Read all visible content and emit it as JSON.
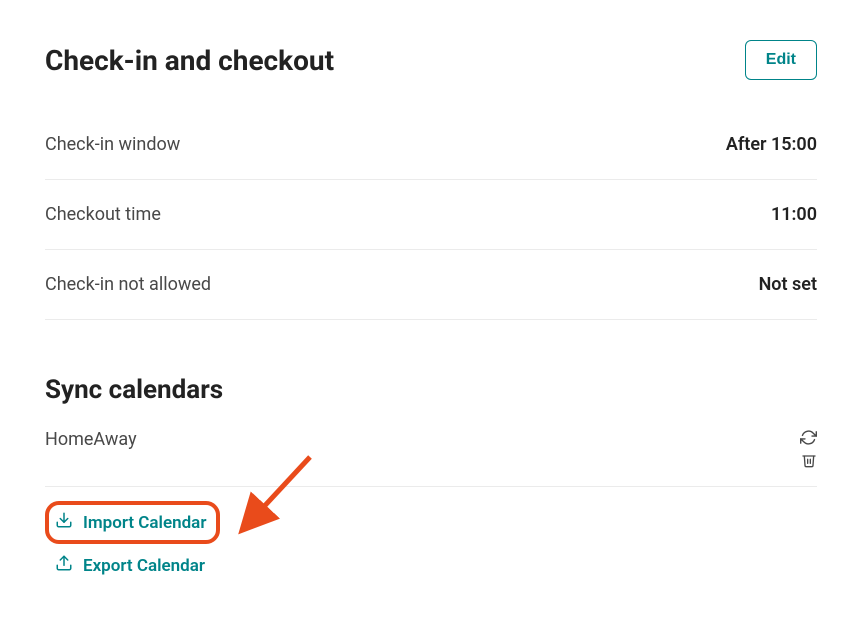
{
  "checkin_checkout": {
    "title": "Check-in and checkout",
    "edit_label": "Edit",
    "rows": [
      {
        "label": "Check-in window",
        "value": "After 15:00"
      },
      {
        "label": "Checkout time",
        "value": "11:00"
      },
      {
        "label": "Check-in not allowed",
        "value": "Not set"
      }
    ]
  },
  "sync_calendars": {
    "title": "Sync calendars",
    "calendar_name": "HomeAway",
    "import_label": "Import Calendar",
    "export_label": "Export Calendar"
  },
  "colors": {
    "accent": "#008489",
    "highlight": "#e94b1b"
  }
}
